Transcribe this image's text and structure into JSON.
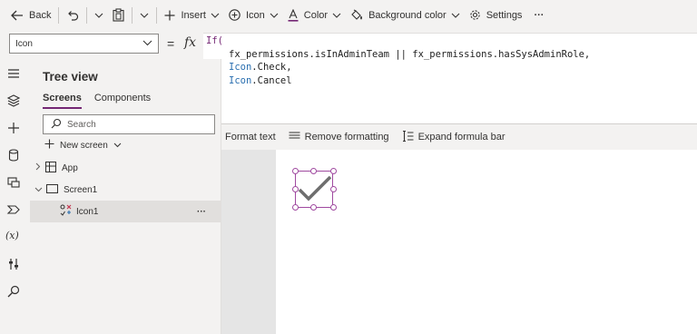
{
  "toolbar": {
    "back_label": "Back",
    "insert_label": "Insert",
    "icon_label": "Icon",
    "color_label": "Color",
    "background_color_label": "Background color",
    "settings_label": "Settings",
    "more_label": "···"
  },
  "formula_bar": {
    "property_value": "Icon",
    "equals": "=",
    "fx": "fx",
    "code": {
      "line1": "If(",
      "line2a": "fx_permissions.isInAdminTeam || fx_permissions.hasSysAdminRole,",
      "line3_obj": "Icon",
      "line3_rest": ".Check,",
      "line4_obj": "Icon",
      "line4_rest": ".Cancel",
      "line5": ")"
    },
    "format_text_label": "Format text",
    "remove_formatting_label": "Remove formatting",
    "expand_formula_bar_label": "Expand formula bar"
  },
  "tree_view": {
    "title": "Tree view",
    "tabs": [
      {
        "label": "Screens",
        "active": true
      },
      {
        "label": "Components",
        "active": false
      }
    ],
    "search_placeholder": "Search",
    "new_screen_label": "New screen",
    "items": [
      {
        "label": "App"
      },
      {
        "label": "Screen1"
      },
      {
        "label": "Icon1"
      }
    ],
    "item_more": "···"
  },
  "colors": {
    "accent": "#742774",
    "selection_handle": "#a04aa0",
    "check_icon": "#6e6e6e"
  },
  "canvas": {
    "selected_icon": "check-icon"
  }
}
